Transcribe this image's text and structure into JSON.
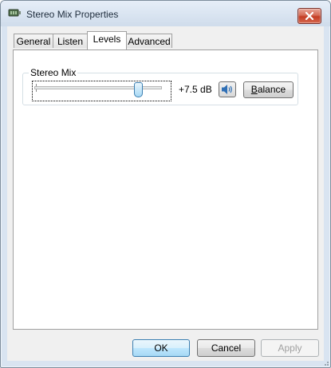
{
  "window": {
    "title": "Stereo Mix Properties",
    "icon": "sound-device-icon"
  },
  "tabs": [
    {
      "label": "General",
      "active": false
    },
    {
      "label": "Listen",
      "active": false
    },
    {
      "label": "Levels",
      "active": true
    },
    {
      "label": "Advanced",
      "active": false
    }
  ],
  "levels": {
    "group_title": "Stereo Mix",
    "slider_level": 0.84,
    "value_text": "+7.5 dB",
    "balance_prefix": "",
    "balance_mnemonic": "B",
    "balance_rest": "alance"
  },
  "footer": {
    "ok_label": "OK",
    "cancel_label": "Cancel",
    "apply_label": "Apply"
  },
  "colors": {
    "close_button": "#c43d24",
    "focus_border": "#3c7fb1"
  }
}
